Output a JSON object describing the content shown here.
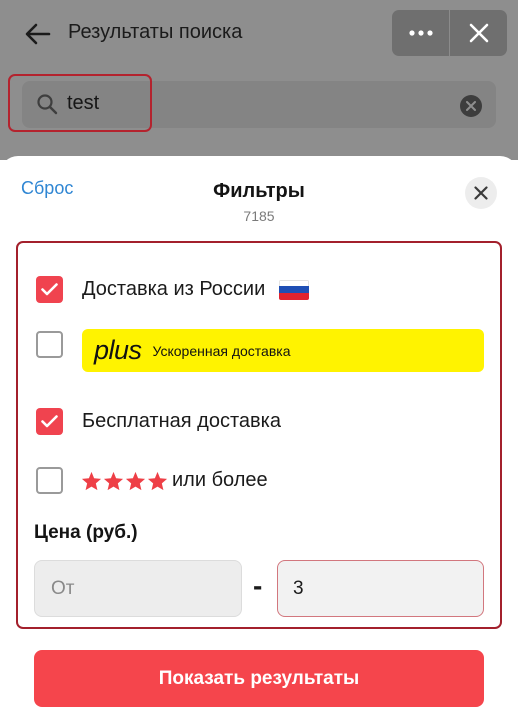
{
  "header": {
    "title": "Результаты поиска",
    "back_icon": "arrow-left-icon",
    "more_icon": "more-dots-icon",
    "close_icon": "close-icon"
  },
  "search": {
    "value": "test",
    "icon": "search-icon",
    "clear_icon": "clear-circle-icon"
  },
  "filters_sheet": {
    "reset_label": "Сброс",
    "title": "Фильтры",
    "count": "7185",
    "close_icon": "close-icon",
    "options": [
      {
        "label": "Доставка из России",
        "checked": true,
        "icon": "russia-flag-icon"
      },
      {
        "brand": "plus",
        "label": "Ускоренная доставка",
        "checked": false
      },
      {
        "label": "Бесплатная доставка",
        "checked": true
      },
      {
        "stars": 4,
        "label": "или более",
        "checked": false
      }
    ],
    "price": {
      "title": "Цена (руб.)",
      "from_placeholder": "От",
      "from_value": "",
      "separator": "-",
      "to_value": "3"
    },
    "show_results_label": "Показать результаты"
  },
  "colors": {
    "accent_red": "#f5454c",
    "checkbox_red": "#f0434f",
    "link_blue": "#2f86d3",
    "plus_yellow": "#fff300",
    "highlight_frame": "#a3202c"
  }
}
